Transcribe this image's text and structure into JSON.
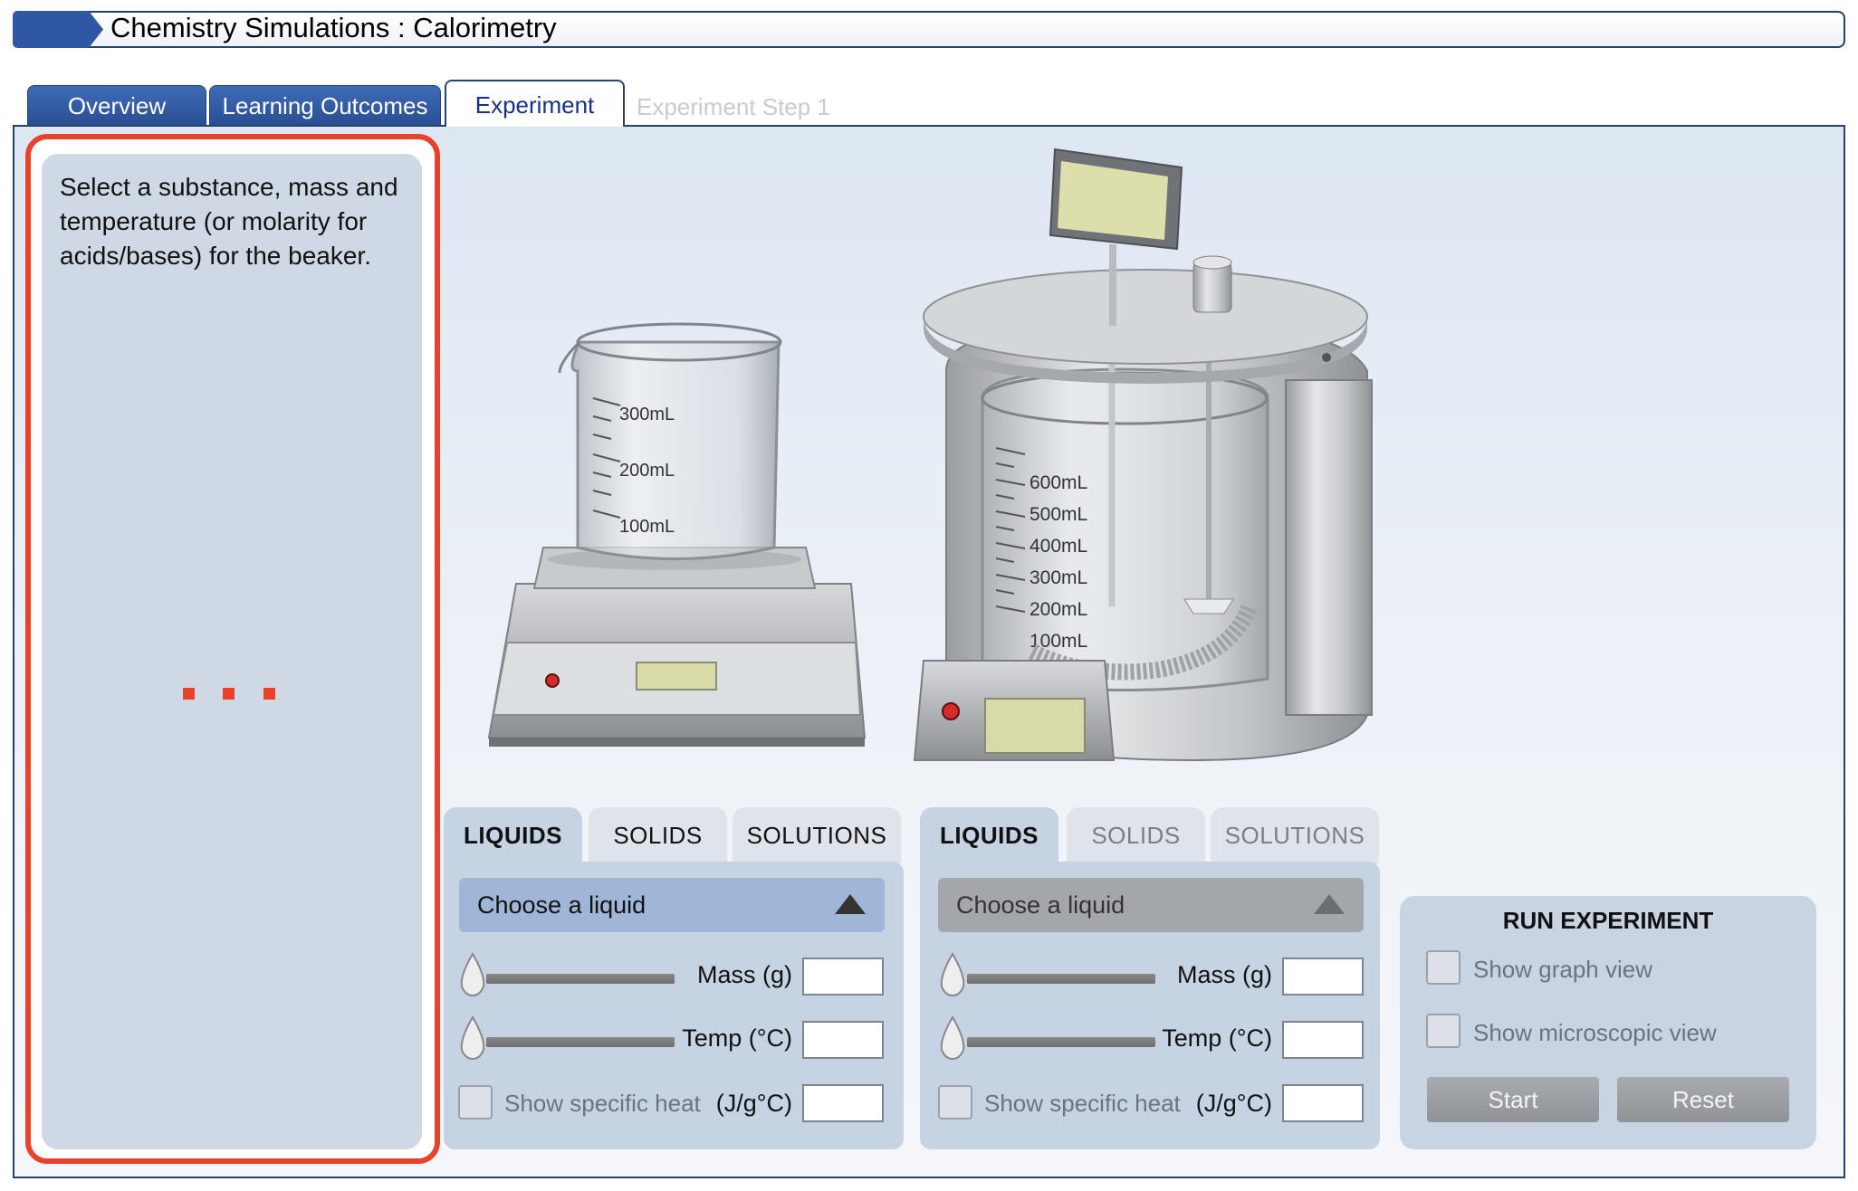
{
  "app": {
    "title": "Chemistry Simulations : Calorimetry"
  },
  "tabs": [
    {
      "label": "Overview"
    },
    {
      "label": "Learning Outcomes"
    },
    {
      "label": "Experiment"
    },
    {
      "label": "Experiment Step 1"
    }
  ],
  "instruction": {
    "text": "Select a substance, mass and temperature (or molarity for acids/bases) for the beaker."
  },
  "beaker": {
    "markings": [
      "300mL",
      "200mL",
      "100mL"
    ]
  },
  "calorimeter": {
    "markings": [
      "600mL",
      "500mL",
      "400mL",
      "300mL",
      "200mL",
      "100mL"
    ]
  },
  "left_panel": {
    "tabs": [
      "LIQUIDS",
      "SOLIDS",
      "SOLUTIONS"
    ],
    "active_tab": "LIQUIDS",
    "dropdown": "Choose a liquid",
    "mass_label": "Mass (g)",
    "temp_label": "Temp (°C)",
    "specific_heat_label": "Show specific heat",
    "specific_heat_unit": "(J/g°C)",
    "mass_value": "",
    "temp_value": "",
    "specific_heat_value": ""
  },
  "right_panel": {
    "tabs": [
      "LIQUIDS",
      "SOLIDS",
      "SOLUTIONS"
    ],
    "active_tab": "LIQUIDS",
    "dropdown": "Choose a liquid",
    "mass_label": "Mass (g)",
    "temp_label": "Temp (°C)",
    "specific_heat_label": "Show specific heat",
    "specific_heat_unit": "(J/g°C)",
    "mass_value": "",
    "temp_value": "",
    "specific_heat_value": ""
  },
  "run": {
    "title": "RUN EXPERIMENT",
    "graph_label": "Show graph view",
    "micro_label": "Show microscopic view",
    "start_label": "Start",
    "reset_label": "Reset"
  },
  "colors": {
    "accent_blue": "#2a4f93",
    "highlight_red": "#e8432a",
    "dropdown_active": "#9fb6d6",
    "dropdown_disabled": "#a3a6ab"
  }
}
